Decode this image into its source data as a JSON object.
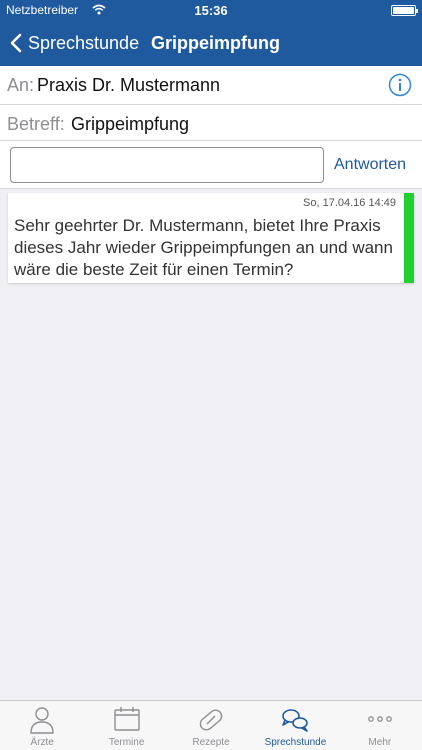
{
  "status_bar": {
    "carrier": "Netzbetreiber",
    "time": "15:36"
  },
  "nav": {
    "back_label": "Sprechstunde",
    "title": "Grippeimpfung"
  },
  "recipient": {
    "label": "An:",
    "value": "Praxis Dr. Mustermann"
  },
  "subject": {
    "label": "Betreff:",
    "value": "Grippeimpfung"
  },
  "reply": {
    "input_value": "",
    "placeholder": "",
    "button_label": "Antworten"
  },
  "message": {
    "date": "So, 17.04.16 14:49",
    "text": "Sehr geehrter Dr. Mustermann, bietet Ihre Praxis dieses Jahr wieder Grippeimpfungen an und wann wäre die beste Zeit für einen Termin?",
    "status_color": "#1fd02f"
  },
  "tabs": [
    {
      "label": "Ärzte",
      "icon": "person-icon",
      "active": false
    },
    {
      "label": "Termine",
      "icon": "calendar-icon",
      "active": false
    },
    {
      "label": "Rezepte",
      "icon": "pill-icon",
      "active": false
    },
    {
      "label": "Sprechstunde",
      "icon": "chat-bubbles-icon",
      "active": true
    },
    {
      "label": "Mehr",
      "icon": "more-icon",
      "active": false
    }
  ],
  "colors": {
    "brand": "#1f5a9e",
    "inactive": "#8e8e93",
    "background": "#efeff4"
  }
}
